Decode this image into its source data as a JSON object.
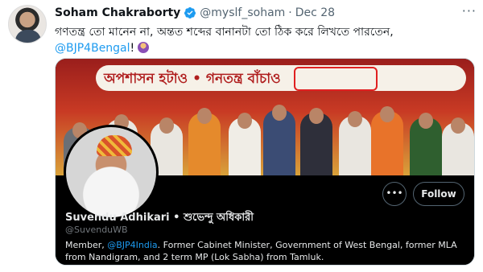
{
  "tweet": {
    "author_name": "Soham Chakraborty",
    "author_handle": "@myslf_soham",
    "separator": "·",
    "date": "Dec 28",
    "more_icon": "ellipsis-icon",
    "text_line1": "গণতন্ত্র তো মানেন না, অন্তত শব্দের বানানটা তো ঠিক করে লিখতে পারতেন,",
    "mention": "@BJP4Bengal",
    "text_suffix": "!"
  },
  "card": {
    "banner_text": "অপশাসন হটাও • গনতন্ত্র বাঁচাও",
    "profile": {
      "display_name": "Suvendu Adhikari • শুভেন্দু অধিকারী",
      "handle": "@SuvenduWB",
      "bio_prefix": "Member, ",
      "bio_mention": "@BJP4India",
      "bio_rest": ". Former Cabinet Minister, Government of West Bengal, former MLA from Nandigram, and 2 term MP (Lok Sabha) from Tamluk.",
      "more_label": "•••",
      "follow_label": "Follow"
    }
  },
  "colors": {
    "link": "#1d9bf0",
    "verified": "#1d9bf0",
    "highlight": "#e02020"
  }
}
